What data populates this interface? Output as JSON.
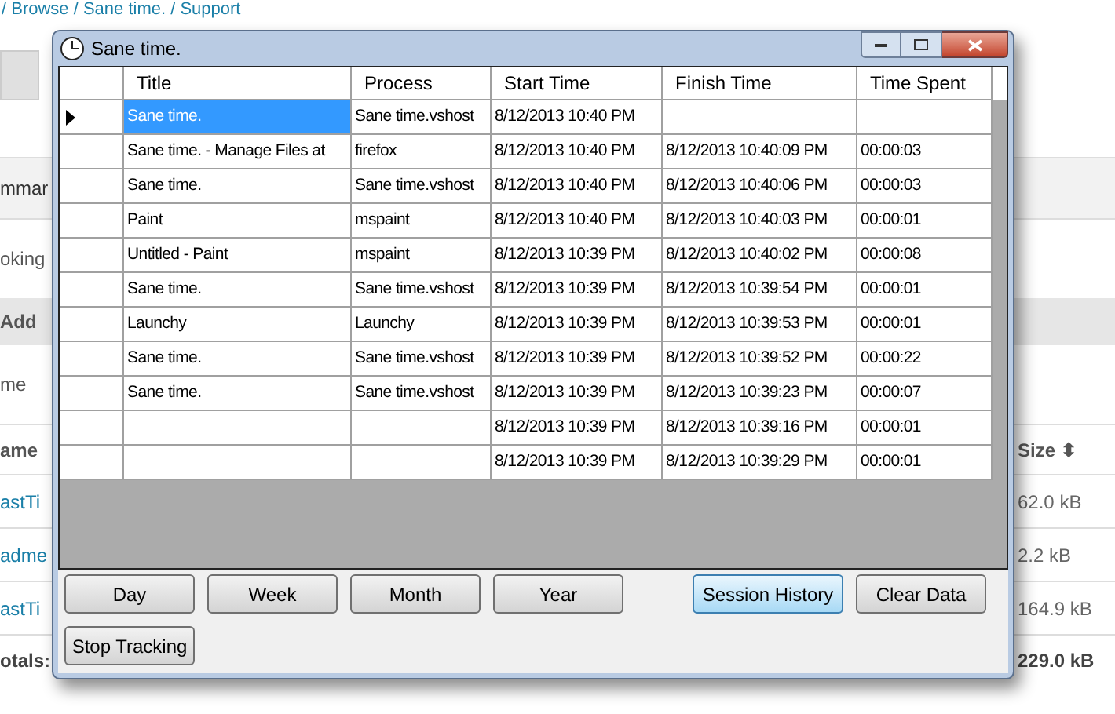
{
  "page": {
    "breadcrumb": "/ Browse / Sane time. / Support",
    "rows": [
      {
        "kind": "band",
        "left": "mmar",
        "right": ""
      },
      {
        "kind": "plain",
        "left": "oking",
        "right": ""
      },
      {
        "kind": "section",
        "left": "Add",
        "right": ""
      },
      {
        "kind": "plain",
        "left": "me",
        "right": ""
      },
      {
        "kind": "header",
        "left": "ame",
        "right": "Size ⬍"
      },
      {
        "kind": "link",
        "left": "astTi",
        "right": "62.0 kB"
      },
      {
        "kind": "link",
        "left": "adme",
        "right": "2.2 kB"
      },
      {
        "kind": "link",
        "left": "astTi",
        "right": "164.9 kB"
      },
      {
        "kind": "total",
        "left": "otals:",
        "right": "229.0 kB"
      }
    ]
  },
  "window": {
    "title": "Sane time.",
    "table": {
      "columns": [
        "Title",
        "Process",
        "Start Time",
        "Finish Time",
        "Time Spent"
      ],
      "rows": [
        {
          "selected": true,
          "cells": [
            "Sane time.",
            "Sane time.vshost",
            "8/12/2013 10:40 PM",
            "",
            ""
          ]
        },
        {
          "selected": false,
          "cells": [
            "Sane time. - Manage Files at",
            "firefox",
            "8/12/2013 10:40 PM",
            "8/12/2013 10:40:09 PM",
            "00:00:03"
          ]
        },
        {
          "selected": false,
          "cells": [
            "Sane time.",
            "Sane time.vshost",
            "8/12/2013 10:40 PM",
            "8/12/2013 10:40:06 PM",
            "00:00:03"
          ]
        },
        {
          "selected": false,
          "cells": [
            "Paint",
            "mspaint",
            "8/12/2013 10:40 PM",
            "8/12/2013 10:40:03 PM",
            "00:00:01"
          ]
        },
        {
          "selected": false,
          "cells": [
            "Untitled - Paint",
            "mspaint",
            "8/12/2013 10:39 PM",
            "8/12/2013 10:40:02 PM",
            "00:00:08"
          ]
        },
        {
          "selected": false,
          "cells": [
            "Sane time.",
            "Sane time.vshost",
            "8/12/2013 10:39 PM",
            "8/12/2013 10:39:54 PM",
            "00:00:01"
          ]
        },
        {
          "selected": false,
          "cells": [
            "Launchy",
            "Launchy",
            "8/12/2013 10:39 PM",
            "8/12/2013 10:39:53 PM",
            "00:00:01"
          ]
        },
        {
          "selected": false,
          "cells": [
            "Sane time.",
            "Sane time.vshost",
            "8/12/2013 10:39 PM",
            "8/12/2013 10:39:52 PM",
            "00:00:22"
          ]
        },
        {
          "selected": false,
          "cells": [
            "Sane time.",
            "Sane time.vshost",
            "8/12/2013 10:39 PM",
            "8/12/2013 10:39:23 PM",
            "00:00:07"
          ]
        },
        {
          "selected": false,
          "cells": [
            "",
            "",
            "8/12/2013 10:39 PM",
            "8/12/2013 10:39:16 PM",
            "00:00:01"
          ]
        },
        {
          "selected": false,
          "cells": [
            "",
            "",
            "8/12/2013 10:39 PM",
            "8/12/2013 10:39:29 PM",
            "00:00:01"
          ]
        }
      ]
    },
    "buttons": [
      {
        "label": "Day",
        "selected": false
      },
      {
        "label": "Week",
        "selected": false
      },
      {
        "label": "Month",
        "selected": false
      },
      {
        "label": "Year",
        "selected": false
      },
      {
        "label": "Session History",
        "selected": true
      },
      {
        "label": "Clear Data",
        "selected": false
      }
    ],
    "bottom_button": "Stop Tracking"
  }
}
